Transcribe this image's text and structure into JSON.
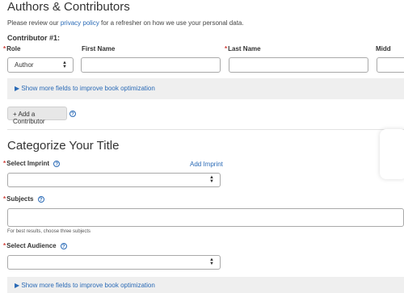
{
  "authors": {
    "heading": "Authors & Contributors",
    "review_prefix": "Please review our ",
    "privacy_link": "privacy policy",
    "review_suffix": " for a refresher on how we use your personal data.",
    "contributor_title": "Contributor #1:",
    "role_label": "Role",
    "role_value": "Author",
    "first_name_label": "First Name",
    "last_name_label": "Last Name",
    "middle_label": "Midd",
    "show_more": "▶ Show more fields to improve book optimization",
    "add_contributor": "+ Add a Contributor"
  },
  "categorize": {
    "heading": "Categorize Your Title",
    "imprint_label": "Select Imprint",
    "add_imprint": "Add Imprint",
    "subjects_label": "Subjects",
    "subjects_hint": "For best results, choose three subjects",
    "audience_label": "Select Audience",
    "show_more": "▶ Show more fields to improve book optimization"
  },
  "icons": {
    "help": "?",
    "required": "*",
    "select_caret": "▲\n▼"
  },
  "colors": {
    "link": "#2a6ab6",
    "required": "#d0403a",
    "band": "#efefef"
  }
}
